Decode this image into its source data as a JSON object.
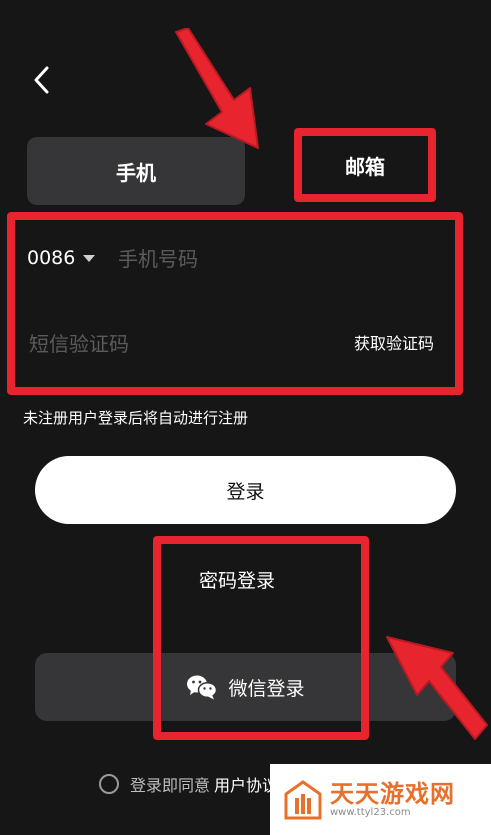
{
  "nav": {
    "back_icon": "chevron-left-icon"
  },
  "tabs": [
    {
      "label": "手机",
      "selected": true
    },
    {
      "label": "邮箱",
      "selected": false
    }
  ],
  "form": {
    "country_code": "0086",
    "phone_placeholder": "手机号码",
    "sms_placeholder": "短信验证码",
    "get_code_label": "获取验证码"
  },
  "notice": "未注册用户登录后将自动进行注册",
  "login_button": "登录",
  "password_login": "密码登录",
  "wechat_button": {
    "label": "微信登录",
    "icon": "wechat-icon"
  },
  "agreement": {
    "prefix": "登录即同意",
    "link": "用户协议"
  },
  "watermark": {
    "name": "天天游戏网",
    "url": "www.ttyl23.com"
  },
  "colors": {
    "annotation": "#e8242f",
    "background": "#161616",
    "panel": "#363638",
    "watermark_brand": "#e9702a"
  }
}
